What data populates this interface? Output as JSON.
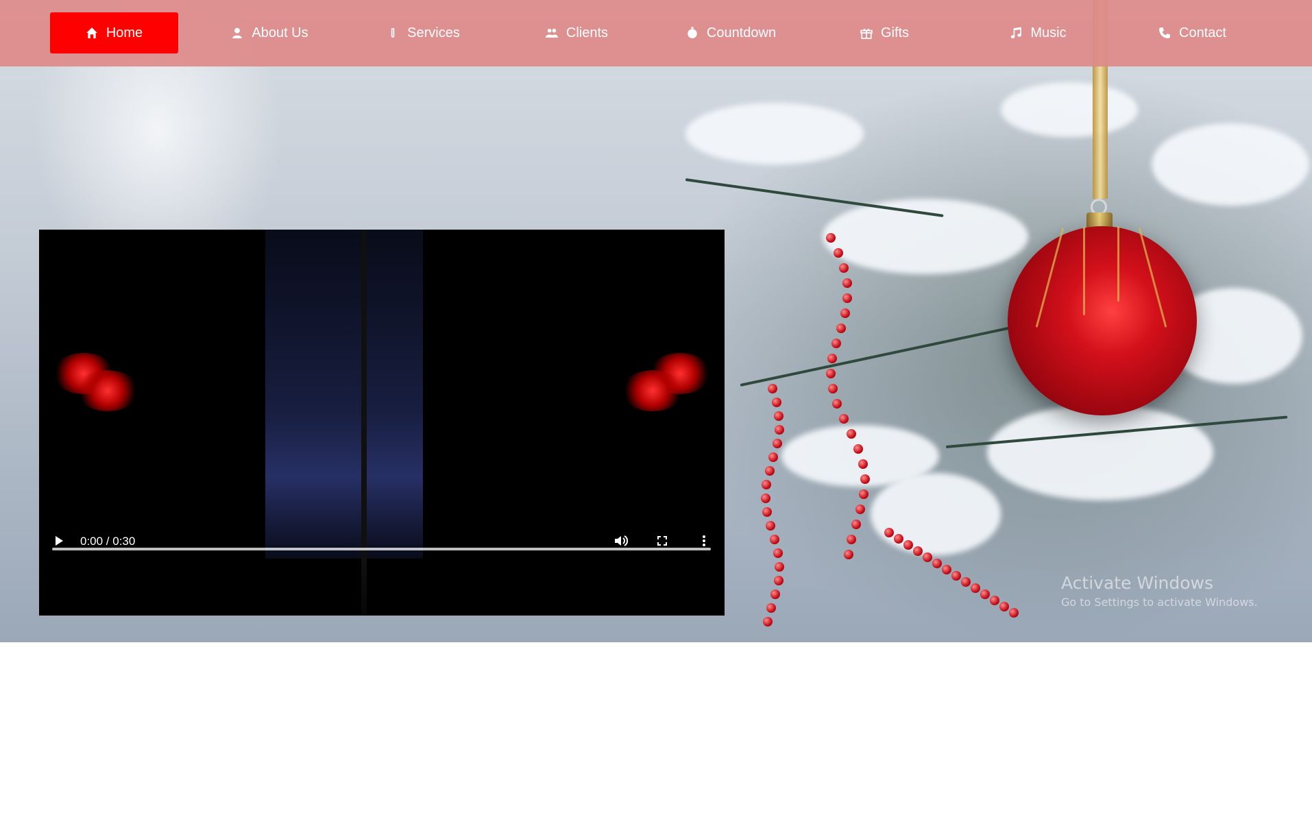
{
  "nav": {
    "items": [
      {
        "label": "Home",
        "icon": "home-icon",
        "active": true
      },
      {
        "label": "About Us",
        "icon": "user-icon"
      },
      {
        "label": "Services",
        "icon": "paperclip-icon"
      },
      {
        "label": "Clients",
        "icon": "users-icon"
      },
      {
        "label": "Countdown",
        "icon": "stopwatch-icon"
      },
      {
        "label": "Gifts",
        "icon": "gift-icon"
      },
      {
        "label": "Music",
        "icon": "music-note-icon"
      },
      {
        "label": "Contact",
        "icon": "phone-icon"
      }
    ],
    "active_color": "#ff0000",
    "bar_color": "#de8a8a"
  },
  "video": {
    "time": "0:00 / 0:30",
    "play_icon": "play-icon",
    "volume_icon": "volume-icon",
    "fullscreen_icon": "fullscreen-icon",
    "more_icon": "more-vertical-icon",
    "progress": 0
  },
  "watermark": {
    "title": "Activate Windows",
    "subtitle": "Go to Settings to activate Windows."
  }
}
